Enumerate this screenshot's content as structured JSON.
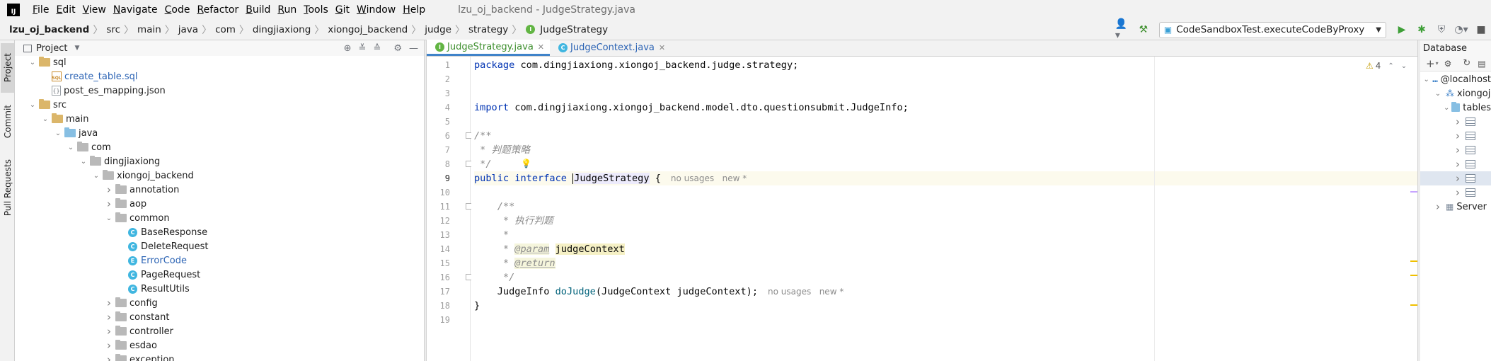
{
  "app": {
    "logo_text": "IJ",
    "window_title": "lzu_oj_backend - JudgeStrategy.java",
    "menu": [
      {
        "mn": "F",
        "rest": "ile"
      },
      {
        "mn": "E",
        "rest": "dit"
      },
      {
        "mn": "V",
        "rest": "iew"
      },
      {
        "mn": "N",
        "rest": "avigate"
      },
      {
        "mn": "C",
        "rest": "ode"
      },
      {
        "mn": "R",
        "rest": "efactor"
      },
      {
        "mn": "B",
        "rest": "uild"
      },
      {
        "mn": "R",
        "rest": "un"
      },
      {
        "mn": "T",
        "rest": "ools"
      },
      {
        "mn": "G",
        "rest": "it"
      },
      {
        "mn": "W",
        "rest": "indow"
      },
      {
        "mn": "H",
        "rest": "elp"
      }
    ]
  },
  "breadcrumb": [
    "lzu_oj_backend",
    "src",
    "main",
    "java",
    "com",
    "dingjiaxiong",
    "xiongoj_backend",
    "judge",
    "strategy",
    "JudgeStrategy"
  ],
  "toolbar": {
    "run_config": "CodeSandboxTest.executeCodeByProxy"
  },
  "left_strip": [
    "Project",
    "Commit",
    "Pull Requests"
  ],
  "project_panel": {
    "title": "Project",
    "tree": [
      {
        "label": "sql",
        "depth": 1,
        "icon": "folder",
        "chev": "down"
      },
      {
        "label": "create_table.sql",
        "depth": 2,
        "icon": "sql",
        "chev": "",
        "blue": true
      },
      {
        "label": "post_es_mapping.json",
        "depth": 2,
        "icon": "json",
        "chev": ""
      },
      {
        "label": "src",
        "depth": 1,
        "icon": "folder",
        "chev": "down"
      },
      {
        "label": "main",
        "depth": 2,
        "icon": "folder",
        "chev": "down"
      },
      {
        "label": "java",
        "depth": 3,
        "icon": "folder-blue",
        "chev": "down"
      },
      {
        "label": "com",
        "depth": 4,
        "icon": "folder-grey",
        "chev": "down"
      },
      {
        "label": "dingjiaxiong",
        "depth": 5,
        "icon": "folder-grey",
        "chev": "down"
      },
      {
        "label": "xiongoj_backend",
        "depth": 6,
        "icon": "folder-grey",
        "chev": "down"
      },
      {
        "label": "annotation",
        "depth": 7,
        "icon": "folder-grey",
        "chev": "right"
      },
      {
        "label": "aop",
        "depth": 7,
        "icon": "folder-grey",
        "chev": "right"
      },
      {
        "label": "common",
        "depth": 7,
        "icon": "folder-grey",
        "chev": "down"
      },
      {
        "label": "BaseResponse",
        "depth": 8,
        "icon": "class",
        "chev": ""
      },
      {
        "label": "DeleteRequest",
        "depth": 8,
        "icon": "class",
        "chev": ""
      },
      {
        "label": "ErrorCode",
        "depth": 8,
        "icon": "enum",
        "chev": "",
        "blue": true
      },
      {
        "label": "PageRequest",
        "depth": 8,
        "icon": "class",
        "chev": ""
      },
      {
        "label": "ResultUtils",
        "depth": 8,
        "icon": "class",
        "chev": ""
      },
      {
        "label": "config",
        "depth": 7,
        "icon": "folder-grey",
        "chev": "right"
      },
      {
        "label": "constant",
        "depth": 7,
        "icon": "folder-grey",
        "chev": "right"
      },
      {
        "label": "controller",
        "depth": 7,
        "icon": "folder-grey",
        "chev": "right"
      },
      {
        "label": "esdao",
        "depth": 7,
        "icon": "folder-grey",
        "chev": "right"
      },
      {
        "label": "exception",
        "depth": 7,
        "icon": "folder-grey",
        "chev": "right"
      }
    ]
  },
  "editor_tabs": [
    {
      "label": "JudgeStrategy.java",
      "active": true,
      "style": "green",
      "icon": "I"
    },
    {
      "label": "JudgeContext.java",
      "active": false,
      "style": "blue",
      "icon": "C"
    }
  ],
  "editor": {
    "warning_count": "4",
    "current_line": 9,
    "lines": [
      {
        "n": "1",
        "segs": [
          [
            "kw",
            "package "
          ],
          [
            "",
            "com.dingjiaxiong.xiongoj_backend.judge.strategy;"
          ]
        ]
      },
      {
        "n": "2",
        "segs": []
      },
      {
        "n": "3",
        "segs": []
      },
      {
        "n": "4",
        "segs": [
          [
            "kw",
            "import "
          ],
          [
            "",
            "com.dingjiaxiong.xiongoj_backend.model.dto.questionsubmit.JudgeInfo;"
          ]
        ]
      },
      {
        "n": "5",
        "segs": []
      },
      {
        "n": "6",
        "segs": [
          [
            "cmt",
            "/**"
          ]
        ]
      },
      {
        "n": "7",
        "segs": [
          [
            "cmt",
            " * 判题策略"
          ]
        ]
      },
      {
        "n": "8",
        "segs": [
          [
            "cmt",
            " */"
          ]
        ]
      },
      {
        "n": "9",
        "segs": [
          [
            "kw",
            "public "
          ],
          [
            "kw",
            "interface "
          ],
          [
            "caret",
            ""
          ],
          [
            "iname",
            "JudgeStrategy"
          ],
          [
            "",
            " {"
          ],
          [
            "hint",
            "no usages   new *"
          ]
        ]
      },
      {
        "n": "10",
        "segs": []
      },
      {
        "n": "11",
        "segs": [
          [
            "cmt",
            "    /**"
          ]
        ]
      },
      {
        "n": "12",
        "segs": [
          [
            "cmt",
            "     * 执行判题"
          ]
        ]
      },
      {
        "n": "13",
        "segs": [
          [
            "cmt",
            "     *"
          ]
        ]
      },
      {
        "n": "14",
        "segs": [
          [
            "cmt",
            "     * "
          ],
          [
            "tag",
            "@param"
          ],
          [
            "cmt",
            " "
          ],
          [
            "param",
            "judgeContext"
          ]
        ]
      },
      {
        "n": "15",
        "segs": [
          [
            "cmt",
            "     * "
          ],
          [
            "tag",
            "@return"
          ]
        ]
      },
      {
        "n": "16",
        "segs": [
          [
            "cmt",
            "     */"
          ]
        ]
      },
      {
        "n": "17",
        "segs": [
          [
            "",
            "    JudgeInfo "
          ],
          [
            "mname",
            "doJudge"
          ],
          [
            "",
            "(JudgeContext judgeContext);"
          ],
          [
            "hint",
            "no usages   new *"
          ]
        ]
      },
      {
        "n": "18",
        "segs": [
          [
            "",
            "}"
          ]
        ]
      },
      {
        "n": "19",
        "segs": []
      }
    ]
  },
  "database_panel": {
    "title": "Database",
    "tree": [
      {
        "label": "@localhost",
        "depth": 0,
        "chev": "down",
        "icon": "host"
      },
      {
        "label": "xiongoj",
        "depth": 1,
        "chev": "down",
        "icon": "schema"
      },
      {
        "label": "tables",
        "depth": 2,
        "chev": "down",
        "icon": "folder"
      },
      {
        "label": "",
        "depth": 3,
        "chev": "right",
        "icon": "table"
      },
      {
        "label": "",
        "depth": 3,
        "chev": "right",
        "icon": "table"
      },
      {
        "label": "",
        "depth": 3,
        "chev": "right",
        "icon": "table"
      },
      {
        "label": "",
        "depth": 3,
        "chev": "right",
        "icon": "table"
      },
      {
        "label": "",
        "depth": 3,
        "chev": "right",
        "icon": "table",
        "selected": true
      },
      {
        "label": "",
        "depth": 3,
        "chev": "right",
        "icon": "table"
      },
      {
        "label": "Server",
        "depth": 1,
        "chev": "right",
        "icon": "server"
      }
    ]
  },
  "colors": {
    "accent": "#4083c9",
    "keyword": "#0033b3",
    "comment": "#8c8c8c",
    "warning": "#c49b00"
  }
}
